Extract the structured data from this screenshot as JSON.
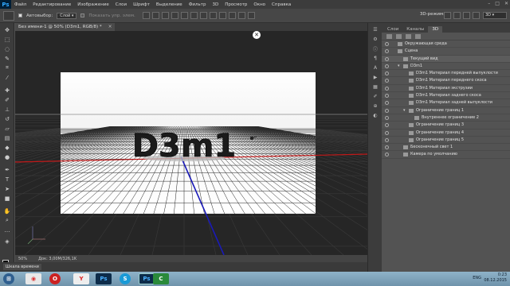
{
  "menubar": {
    "logo": "Ps",
    "items": [
      "Файл",
      "Редактирование",
      "Изображение",
      "Слои",
      "Шрифт",
      "Выделение",
      "Фильтр",
      "3D",
      "Просмотр",
      "Окно",
      "Справка"
    ],
    "window_controls": [
      "–",
      "□",
      "✕"
    ]
  },
  "options": {
    "autoselect_label": "Автовыбор:",
    "autoselect_value": "Слой",
    "show_controls_label": "Показать упр. элем.",
    "mode_3d_label": "3D-режим:",
    "workspace": "3D"
  },
  "document": {
    "tab_title": "Без имени-1 @ 50% (D3m1, RGB/8) *",
    "scene_text": "D3m1"
  },
  "status": {
    "zoom": "50%",
    "doc_info": "Док: 3,00M/326,1K"
  },
  "timeline": {
    "tab_label": "Шкала времени"
  },
  "panel": {
    "tabs": [
      "Слои",
      "Каналы",
      "3D"
    ],
    "active_tab": "3D",
    "tree": [
      {
        "label": "Окружающая среда",
        "indent": 0,
        "icon": "environment-icon"
      },
      {
        "label": "Сцена",
        "indent": 0,
        "icon": "scene-icon"
      },
      {
        "label": "Текущий вид",
        "indent": 1,
        "icon": "camera-icon",
        "selected": true
      },
      {
        "label": "D3m1",
        "indent": 1,
        "icon": "mesh-icon",
        "twirl": "▾"
      },
      {
        "label": "D3m1 Материал передней выпуклости",
        "indent": 2,
        "icon": "material-icon"
      },
      {
        "label": "D3m1 Материал переднего скоса",
        "indent": 2,
        "icon": "material-icon"
      },
      {
        "label": "D3m1 Материал экструзии",
        "indent": 2,
        "icon": "material-icon"
      },
      {
        "label": "D3m1 Материал заднего скоса",
        "indent": 2,
        "icon": "material-icon"
      },
      {
        "label": "D3m1 Материал задней выпуклости",
        "indent": 2,
        "icon": "material-icon"
      },
      {
        "label": "Ограничение границ 1",
        "indent": 2,
        "icon": "constraint-icon",
        "twirl": "▾"
      },
      {
        "label": "Внутреннее ограничение 2",
        "indent": 3,
        "icon": "constraint-icon"
      },
      {
        "label": "Ограничение границ 3",
        "indent": 2,
        "icon": "constraint-icon"
      },
      {
        "label": "Ограничение границ 4",
        "indent": 2,
        "icon": "constraint-icon"
      },
      {
        "label": "Ограничение границ 5",
        "indent": 2,
        "icon": "constraint-icon"
      },
      {
        "label": "Бесконечный свет 1",
        "indent": 1,
        "icon": "light-icon"
      },
      {
        "label": "Камера по умолчанию",
        "indent": 1,
        "icon": "camera-icon"
      }
    ]
  },
  "taskbar": {
    "apps": [
      "start-orb",
      "chrome",
      "opera",
      "yandex",
      "photoshop",
      "skype",
      "photoshop-2",
      "camtasia"
    ],
    "lang": "ENG",
    "time": "0:23",
    "date": "08.12.2015"
  }
}
